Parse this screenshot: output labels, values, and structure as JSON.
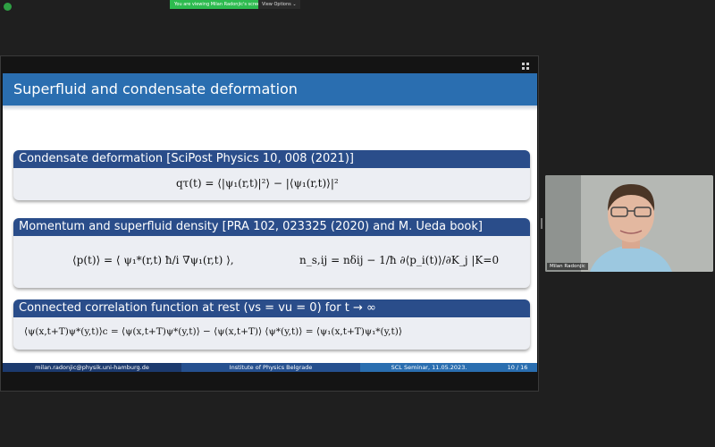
{
  "zoom_bar": {
    "share_notice": "You are viewing Milan Radonjic's screen",
    "view_options": "View Options ⌄"
  },
  "slide": {
    "title": "Superfluid and condensate deformation",
    "blocks": [
      {
        "title": "Condensate deformation [SciPost Physics 10, 008 (2021)]",
        "equation": "qτ(t) = ⟨|ψ₁(r,t)|²⟩ − |⟨ψ₁(r,t)⟩|²"
      },
      {
        "title": "Momentum and superfluid density [PRA 102, 023325 (2020) and M. Ueda book]",
        "equation_left": "⟨p(t)⟩ = ⟨ ψ₁*(r,t) ħ/i ∇ψ₁(r,t) ⟩,",
        "equation_right": "n_s,ij = nδij − 1/ħ ∂⟨p_i(t)⟩/∂K_j |K=0"
      },
      {
        "title": "Connected correlation function at rest (vs = vu = 0) for t → ∞",
        "equation": "⟨ψ(x,t+T)ψ*(y,t)⟩c = ⟨ψ(x,t+T)ψ*(y,t)⟩ − ⟨ψ(x,t+T)⟩ ⟨ψ*(y,t)⟩ = ⟨ψ₁(x,t+T)ψ₁*(y,t)⟩"
      }
    ],
    "footer": {
      "email": "milan.radonjic@physik.uni-hamburg.de",
      "institute": "Institute of Physics Belgrade",
      "seminar": "SCL Seminar, 11.05.2023.",
      "page": "10 / 16"
    }
  },
  "participant": {
    "name": "Milan Radonjic"
  },
  "colors": {
    "header": "#2a6eb0",
    "block_title": "#2a4d8a",
    "footer_dark": "#1c3a6e",
    "footer_mid": "#25508f",
    "footer_light": "#2a6eb0",
    "share_green": "#2dbb4f"
  }
}
